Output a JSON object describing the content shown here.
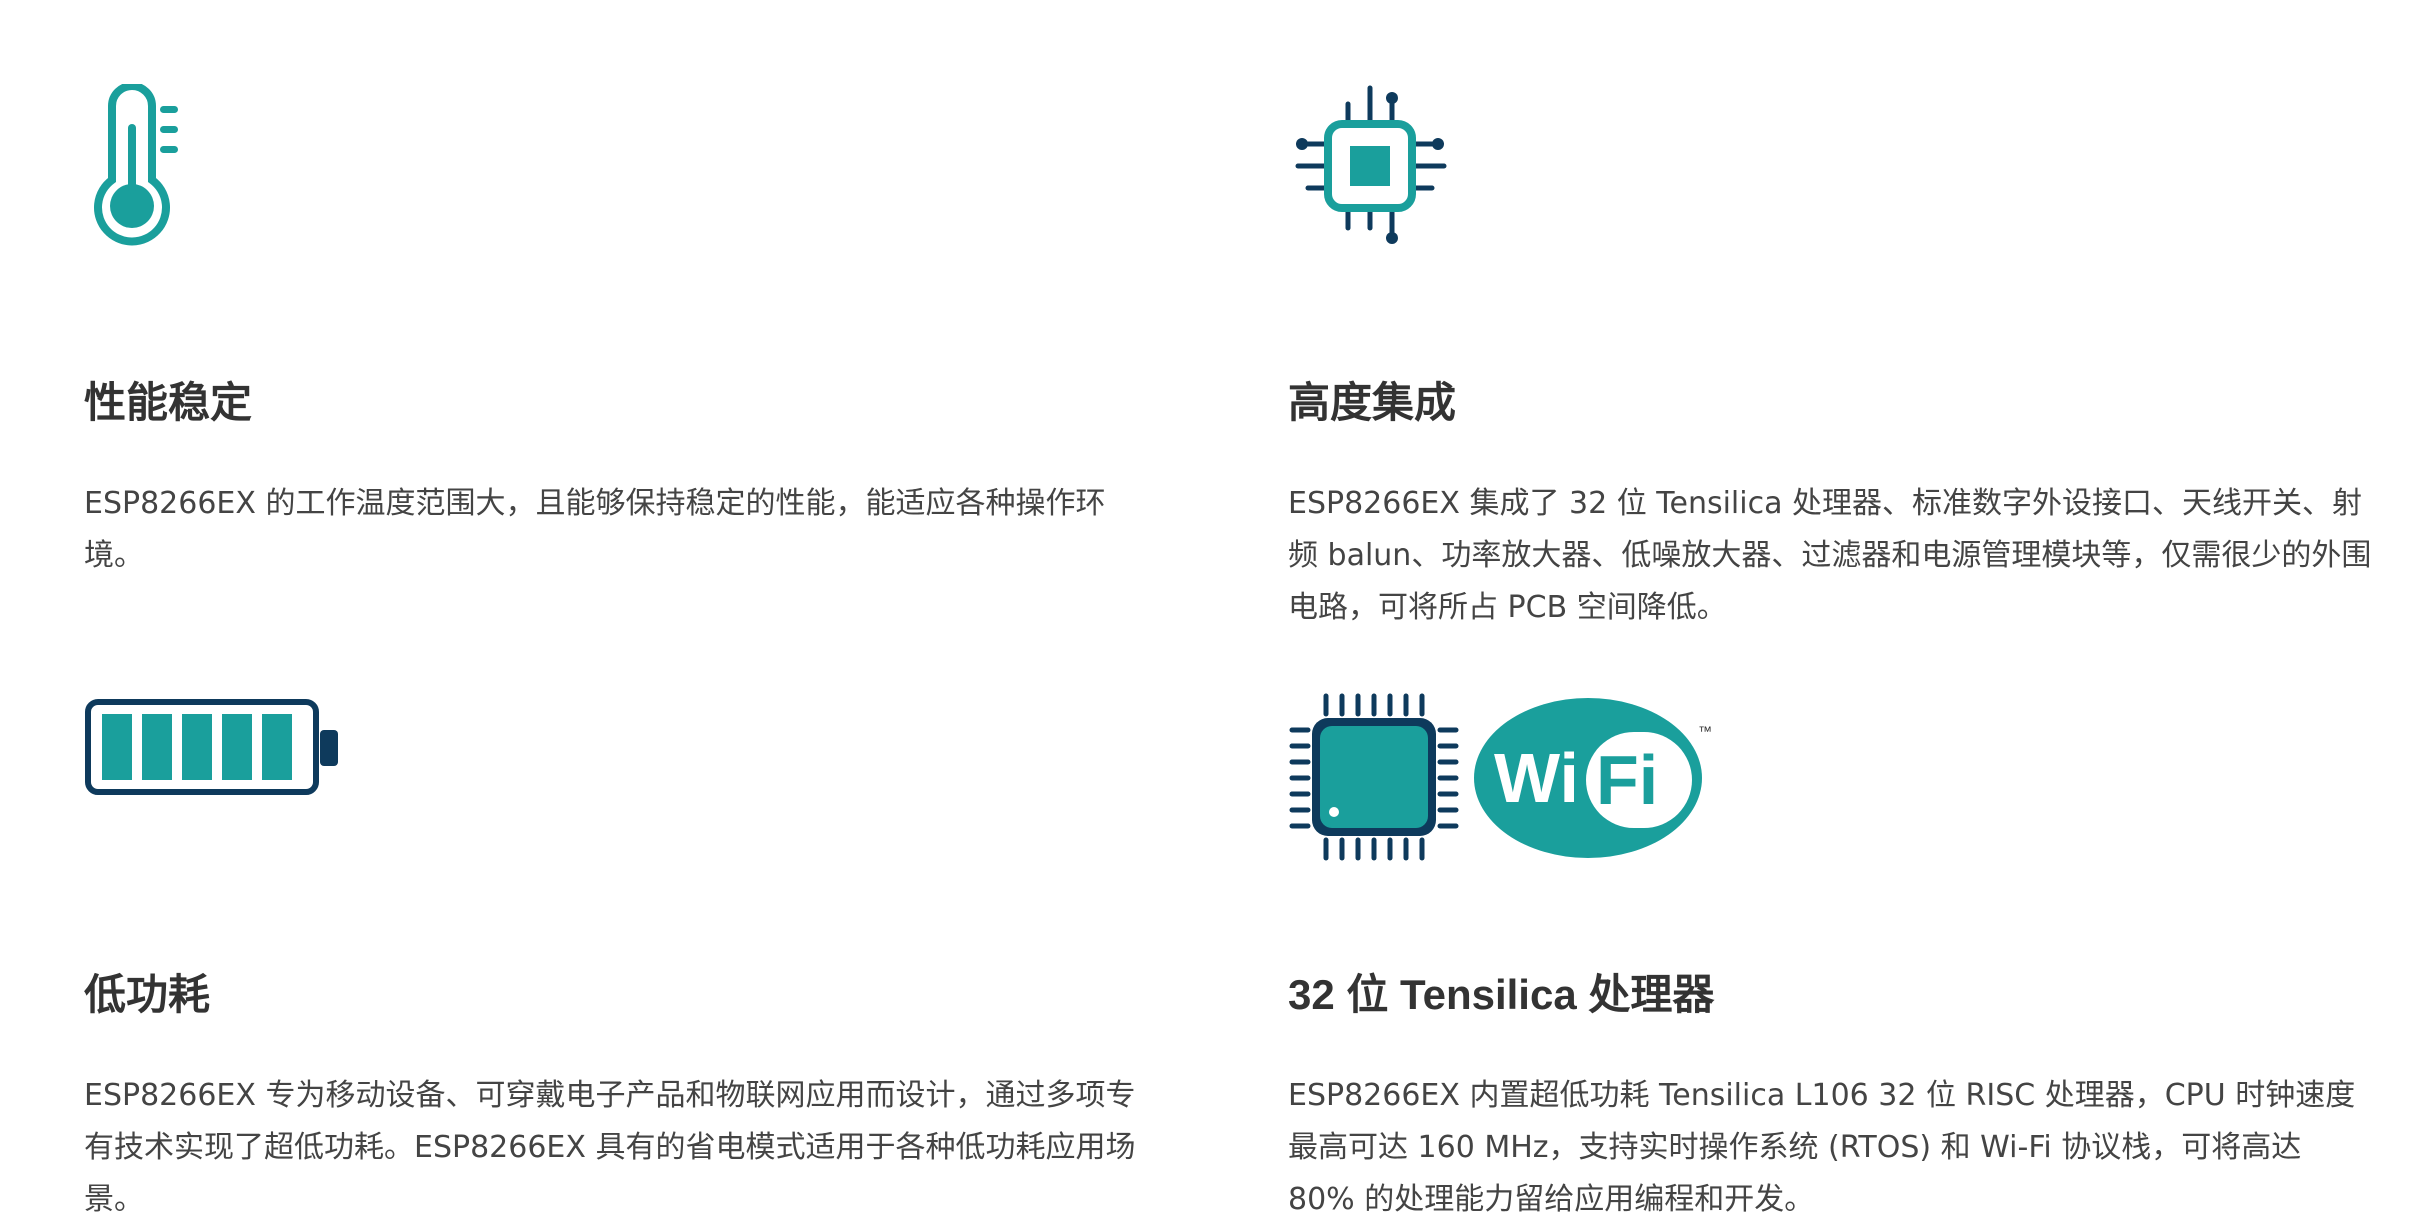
{
  "colors": {
    "teal": "#1a9f9c",
    "navy": "#0e3a5c",
    "text": "#333333"
  },
  "features": [
    {
      "icon": "thermometer-icon",
      "title": "性能稳定",
      "description": "ESP8266EX 的工作温度范围大，且能够保持稳定的性能，能适应各种操作环境。"
    },
    {
      "icon": "chip-icon",
      "title": "高度集成",
      "description": "ESP8266EX 集成了 32 位 Tensilica 处理器、标准数字外设接口、天线开关、射频 balun、功率放大器、低噪放大器、过滤器和电源管理模块等，仅需很少的外围电路，可将所占 PCB 空间降低。"
    },
    {
      "icon": "battery-icon",
      "title": "低功耗",
      "description": "ESP8266EX 专为移动设备、可穿戴电子产品和物联网应用而设计，通过多项专有技术实现了超低功耗。ESP8266EX 具有的省电模式适用于各种低功耗应用场景。"
    },
    {
      "icon": "processor-wifi-icon",
      "title": "32 位 Tensilica 处理器",
      "wifi_logo_text": "Wi Fi",
      "wifi_tm": "™",
      "description": "ESP8266EX 内置超低功耗 Tensilica L106 32 位 RISC 处理器，CPU 时钟速度最高可达 160 MHz，支持实时操作系统 (RTOS) 和 Wi-Fi 协议栈，可将高达 80% 的处理能力留给应用编程和开发。"
    }
  ]
}
